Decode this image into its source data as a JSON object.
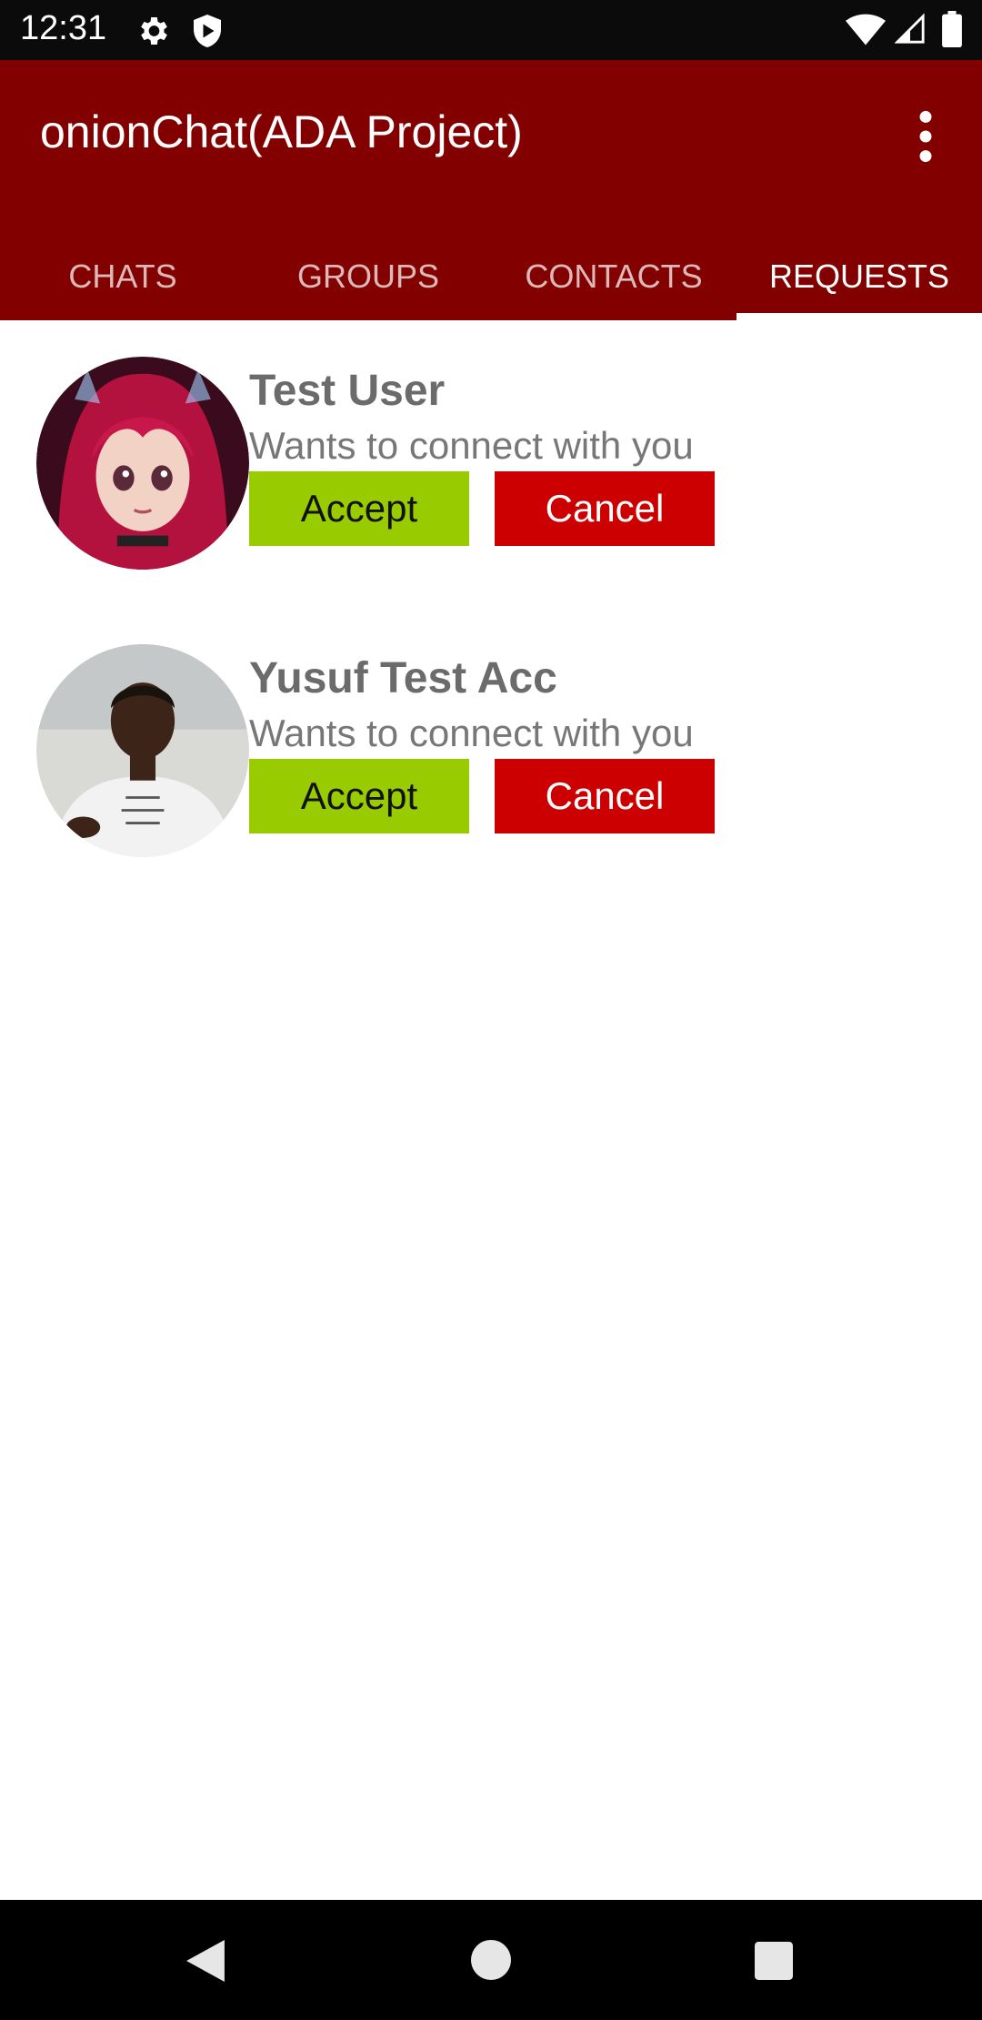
{
  "status_bar": {
    "time": "12:31",
    "icons": [
      "gear-icon",
      "shield-icon",
      "wifi-icon",
      "signal-icon",
      "battery-icon"
    ]
  },
  "app_bar": {
    "title": "onionChat(ADA Project)",
    "color": "#820000",
    "tabs": [
      {
        "label": "CHATS",
        "active": false
      },
      {
        "label": "GROUPS",
        "active": false
      },
      {
        "label": "CONTACTS",
        "active": false
      },
      {
        "label": "REQUESTS",
        "active": true
      }
    ]
  },
  "requests": [
    {
      "name": "Test User",
      "message": "Wants to connect with you",
      "accept_label": "Accept",
      "cancel_label": "Cancel"
    },
    {
      "name": "Yusuf Test Acc",
      "message": "Wants to connect with you",
      "accept_label": "Accept",
      "cancel_label": "Cancel"
    }
  ],
  "colors": {
    "accept": "#99cc00",
    "cancel": "#cc0000"
  },
  "nav_bar": {
    "icons": [
      "back-icon",
      "home-icon",
      "recents-icon"
    ]
  }
}
